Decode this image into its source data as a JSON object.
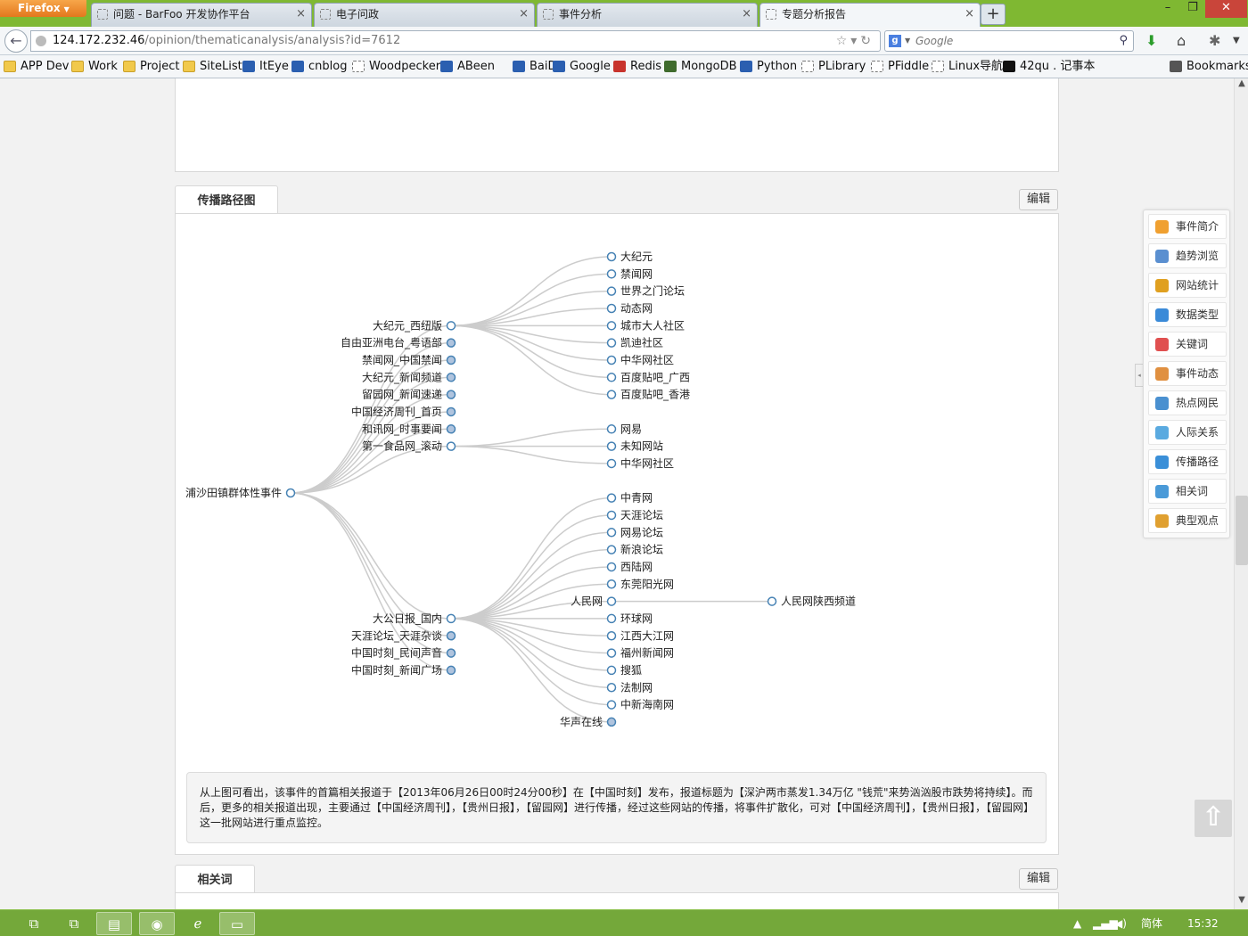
{
  "browser": {
    "app_button": "Firefox",
    "tabs": [
      {
        "title": "问题 - BarFoo 开发协作平台",
        "active": false
      },
      {
        "title": "电子问政",
        "active": false
      },
      {
        "title": "事件分析",
        "active": false
      },
      {
        "title": "专题分析报告",
        "active": true
      }
    ],
    "url_host": "124.172.232.46",
    "url_path": "/opinion/thematicanalysis/analysis?id=7612",
    "search_placeholder": "Google",
    "bookmarks": [
      {
        "label": "APP Dev",
        "icon": "folder"
      },
      {
        "label": "Work",
        "icon": "folder"
      },
      {
        "label": "Project",
        "icon": "folder"
      },
      {
        "label": "SiteList",
        "icon": "folder"
      },
      {
        "label": "ItEye",
        "icon": "blue"
      },
      {
        "label": "cnblog",
        "icon": "blue"
      },
      {
        "label": "Woodpecker",
        "icon": "page"
      },
      {
        "label": "ABeen",
        "icon": "blue"
      },
      {
        "label": "BaiDu",
        "icon": "blue"
      },
      {
        "label": "Google",
        "icon": "blue"
      },
      {
        "label": "Redis",
        "icon": "red"
      },
      {
        "label": "MongoDB",
        "icon": "green"
      },
      {
        "label": "Python",
        "icon": "blue"
      },
      {
        "label": "PLibrary",
        "icon": "page"
      },
      {
        "label": "PFiddle",
        "icon": "page"
      },
      {
        "label": "Linux导航",
        "icon": "page"
      },
      {
        "label": "42qu . 记事本",
        "icon": "black"
      }
    ],
    "bookmarks_menu": "Bookmarks"
  },
  "propagation": {
    "tab_label": "传播路径图",
    "edit_label": "编辑",
    "tree": {
      "root": "浦沙田镇群体性事件",
      "level1": [
        "大纪元_西纽版",
        "自由亚洲电台_粤语部",
        "禁闻网_中国禁闻",
        "大纪元_新闻频道",
        "留园网_新闻速递",
        "中国经济周刊_首页",
        "和讯网_时事要闻",
        "第一食品网_滚动",
        "大公日报_国内",
        "天涯论坛_天涯杂谈",
        "中国时刻_民间声音",
        "中国时刻_新闻广场"
      ],
      "group_dajiyuan": [
        "大纪元",
        "禁闻网",
        "世界之门论坛",
        "动态网",
        "城市大人社区",
        "凯迪社区",
        "中华网社区",
        "百度贴吧_广西",
        "百度贴吧_香港"
      ],
      "group_food": [
        "网易",
        "未知网站",
        "中华网社区"
      ],
      "group_dagong": [
        "中青网",
        "天涯论坛",
        "网易论坛",
        "新浪论坛",
        "西陆网",
        "东莞阳光网",
        "人民网",
        "环球网",
        "江西大江网",
        "福州新闻网",
        "搜狐",
        "法制网",
        "中新海南网",
        "华声在线"
      ],
      "renmin_child": "人民网陕西频道"
    },
    "summary": "从上图可看出，该事件的首篇相关报道于【2013年06月26日00时24分00秒】在【中国时刻】发布，报道标题为【深沪两市蒸发1.34万亿 \"钱荒\"来势汹汹股市跌势将持续】。而后，更多的相关报道出现，主要通过【中国经济周刊】，【贵州日报】，【留园网】进行传播，经过这些网站的传播，将事件扩散化，可对【中国经济周刊】，【贵州日报】，【留园网】这一批网站进行重点监控。"
  },
  "related": {
    "tab_label": "相关词",
    "edit_label": "编辑"
  },
  "side_nav": [
    {
      "label": "事件简介",
      "icon": "book-icon",
      "color": "#f0a030"
    },
    {
      "label": "趋势浏览",
      "icon": "trend-icon",
      "color": "#5a8fd0"
    },
    {
      "label": "网站统计",
      "icon": "bar-chart-icon",
      "color": "#e0a020"
    },
    {
      "label": "数据类型",
      "icon": "database-icon",
      "color": "#3a8ad8"
    },
    {
      "label": "关键词",
      "icon": "keyword-icon",
      "color": "#e05050"
    },
    {
      "label": "事件动态",
      "icon": "dynamic-icon",
      "color": "#e09040"
    },
    {
      "label": "热点网民",
      "icon": "user-icon",
      "color": "#4a90d0"
    },
    {
      "label": "人际关系",
      "icon": "network-icon",
      "color": "#5aaae0"
    },
    {
      "label": "传播路径",
      "icon": "globe-icon",
      "color": "#3a8fd8"
    },
    {
      "label": "相关词",
      "icon": "signal-icon",
      "color": "#4a9ad8"
    },
    {
      "label": "典型观点",
      "icon": "thumb-icon",
      "color": "#e0a030"
    }
  ],
  "taskbar": {
    "ime": "简体",
    "clock": "15:32"
  }
}
